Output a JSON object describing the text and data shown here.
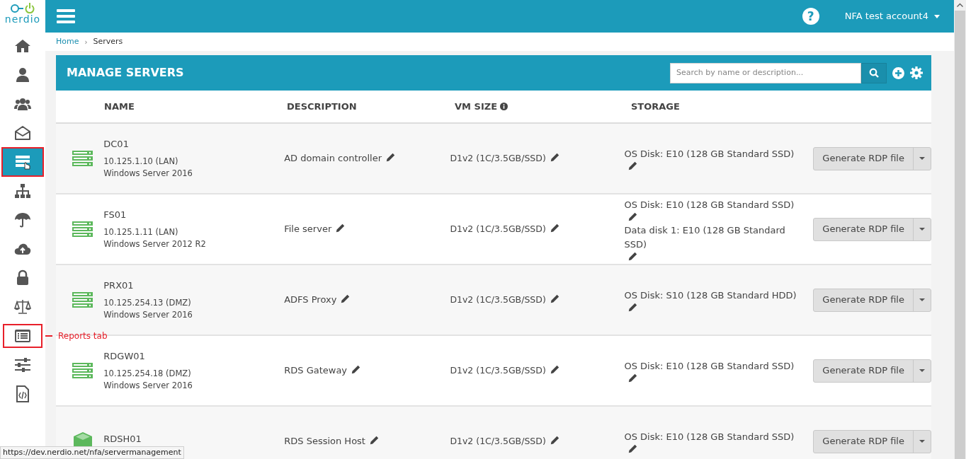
{
  "logo": {
    "text": "nerdio"
  },
  "sidebar": {
    "items": [
      {
        "kind": "home",
        "selected": false,
        "highlighted": false
      },
      {
        "kind": "user",
        "selected": false,
        "highlighted": false
      },
      {
        "kind": "users",
        "selected": false,
        "highlighted": false
      },
      {
        "kind": "envelope",
        "selected": false,
        "highlighted": false
      },
      {
        "kind": "server",
        "selected": true,
        "highlighted": true
      },
      {
        "kind": "sitemap",
        "selected": false,
        "highlighted": false
      },
      {
        "kind": "umbrella",
        "selected": false,
        "highlighted": false
      },
      {
        "kind": "cloud",
        "selected": false,
        "highlighted": false
      },
      {
        "kind": "lock",
        "selected": false,
        "highlighted": false
      },
      {
        "kind": "scale",
        "selected": false,
        "highlighted": false
      },
      {
        "kind": "list",
        "selected": false,
        "highlighted": true,
        "annotation": "Reports tab"
      },
      {
        "kind": "sliders",
        "selected": false,
        "highlighted": false
      },
      {
        "kind": "code",
        "selected": false,
        "highlighted": false
      }
    ]
  },
  "topbar": {
    "help": "?",
    "account": "NFA test account4"
  },
  "breadcrumb": [
    "Home",
    "Servers"
  ],
  "breadcrumb_separator": "›",
  "panel": {
    "title": "MANAGE SERVERS",
    "search": {
      "placeholder": "Search by name or description..."
    }
  },
  "table": {
    "columns": [
      "NAME",
      "DESCRIPTION",
      "VM SIZE",
      "STORAGE"
    ],
    "rows": [
      {
        "kind": "server",
        "name": "DC01",
        "ip": "10.125.1.10 (LAN)",
        "os": "Windows Server 2016",
        "description": "AD domain controller",
        "vm_size": "D1v2 (1C/3.5GB/SSD)",
        "storage": [
          "OS Disk: E10 (128 GB Standard SSD)"
        ],
        "action": "Generate RDP file"
      },
      {
        "kind": "server",
        "name": "FS01",
        "ip": "10.125.1.11 (LAN)",
        "os": "Windows Server 2012 R2",
        "description": "File server",
        "vm_size": "D1v2 (1C/3.5GB/SSD)",
        "storage": [
          "OS Disk: E10 (128 GB Standard SSD)",
          "Data disk 1: E10 (128 GB Standard SSD)"
        ],
        "action": "Generate RDP file"
      },
      {
        "kind": "server",
        "name": "PRX01",
        "ip": "10.125.254.13 (DMZ)",
        "os": "Windows Server 2016",
        "description": "ADFS Proxy",
        "vm_size": "D1v2 (1C/3.5GB/SSD)",
        "storage": [
          "OS Disk: S10 (128 GB Standard HDD)"
        ],
        "action": "Generate RDP file"
      },
      {
        "kind": "server",
        "name": "RDGW01",
        "ip": "10.125.254.18 (DMZ)",
        "os": "Windows Server 2016",
        "description": "RDS Gateway",
        "vm_size": "D1v2 (1C/3.5GB/SSD)",
        "storage": [
          "OS Disk: E10 (128 GB Standard SSD)"
        ],
        "action": "Generate RDP file"
      },
      {
        "kind": "cube",
        "name": "RDSH01",
        "description": "RDS Session Host",
        "vm_size": "D1v2 (1C/3.5GB/SSD)",
        "storage": [
          "OS Disk: E10 (128 GB Standard SSD)"
        ],
        "action": "Generate RDP file"
      }
    ]
  },
  "status_url": "https://dev.nerdio.net/nfa/servermanagement"
}
